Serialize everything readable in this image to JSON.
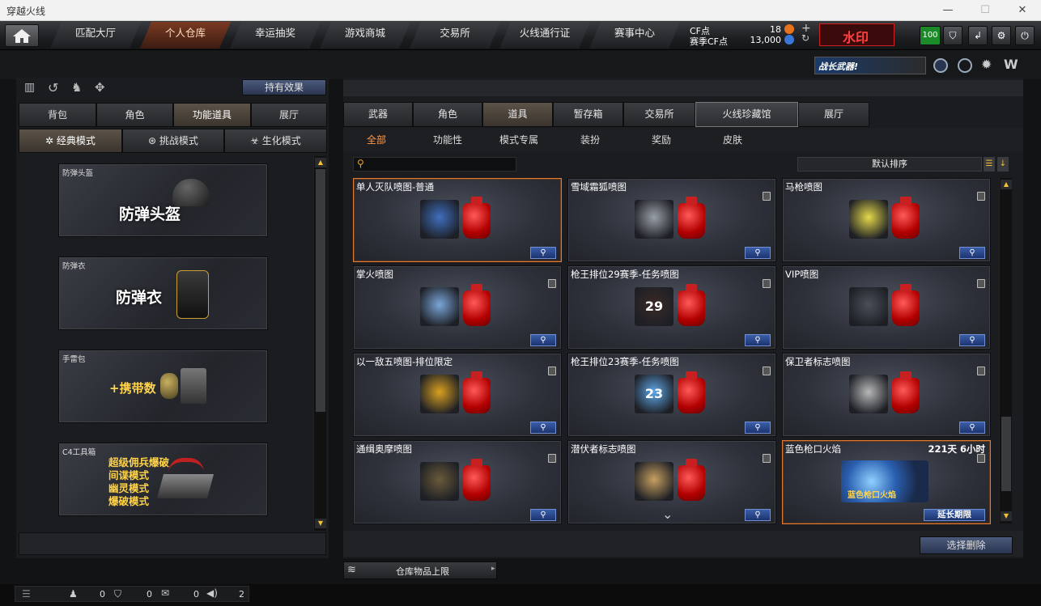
{
  "window": {
    "title": "穿越火线"
  },
  "nav": {
    "tabs": [
      "匹配大厅",
      "个人仓库",
      "幸运抽奖",
      "游戏商城",
      "交易所",
      "火线通行证",
      "赛事中心"
    ],
    "active": "个人仓库"
  },
  "currency": {
    "cf_label": "CF点",
    "cf_value": "18",
    "season_label": "赛季CF点",
    "season_value": "13,000"
  },
  "badge": {
    "text": "水印",
    "level": "100"
  },
  "banner": {
    "text": "战长武器!"
  },
  "left": {
    "effect_button": "持有效果",
    "tabs": [
      "背包",
      "角色",
      "功能道具",
      "展厅"
    ],
    "active_tab": "功能道具",
    "modes": [
      "经典模式",
      "挑战模式",
      "生化模式"
    ],
    "active_mode": "经典模式",
    "cards": [
      {
        "caption": "防弹头盔",
        "title": "防弹头盔"
      },
      {
        "caption": "防弹衣",
        "title": "防弹衣"
      },
      {
        "caption": "手雷包",
        "title": "+携带数"
      },
      {
        "caption": "C4工具箱",
        "lines": [
          "超级佣兵爆破",
          "间谍模式",
          "幽灵模式",
          "爆破模式"
        ]
      }
    ]
  },
  "right": {
    "tabs": [
      "武器",
      "角色",
      "道具",
      "暂存箱",
      "交易所",
      "火线珍藏馆",
      "展厅"
    ],
    "active_tab": "道具",
    "selected_tab": "火线珍藏馆",
    "subtabs": [
      "全部",
      "功能性",
      "模式专属",
      "装扮",
      "奖励",
      "皮肤"
    ],
    "active_subtab": "全部",
    "search": {
      "placeholder": ""
    },
    "sort": "默认排序",
    "items": [
      {
        "name": "单人灭队喷图-普通",
        "highlight": true,
        "color": "#3f6fbf"
      },
      {
        "name": "雪域霜狐喷图",
        "color": "#9aa0a8"
      },
      {
        "name": "马枪喷图",
        "color": "#e5d94a"
      },
      {
        "name": "掌火喷图",
        "color": "#7aa6d8"
      },
      {
        "name": "枪王排位29赛季-任务喷图",
        "color": "#3a2a26",
        "label": "29"
      },
      {
        "name": "VIP喷图",
        "color": "#4a4f58"
      },
      {
        "name": "以一敌五喷图-排位限定",
        "color": "#d9a020"
      },
      {
        "name": "枪王排位23赛季-任务喷图",
        "color": "#5fa8e8",
        "label": "23"
      },
      {
        "name": "保卫者标志喷图",
        "color": "#b8b8b8"
      },
      {
        "name": "通缉奥摩喷图",
        "color": "#6a5a3a"
      },
      {
        "name": "潜伏者标志喷图",
        "color": "#c8a060"
      },
      {
        "name": "蓝色枪口火焰",
        "highlight": true,
        "time": "221天 6小时",
        "label": "蓝色枪口火焰",
        "extend": "延长期限"
      }
    ],
    "delete_button": "选择删除",
    "limit_label": "仓库物品上限"
  },
  "statusbar": {
    "friends": "0",
    "shield": "0",
    "chat": "0",
    "volume": "2"
  }
}
